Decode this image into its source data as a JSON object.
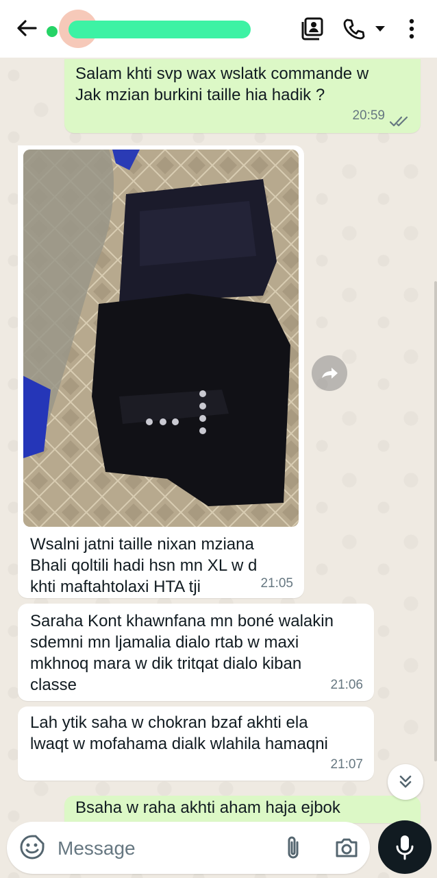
{
  "header": {
    "contact_name": "",
    "icons": [
      "back-arrow-icon",
      "contact-card-icon",
      "phone-icon",
      "caret-down-icon",
      "more-vertical-icon"
    ]
  },
  "messages": [
    {
      "direction": "outgoing",
      "text": "Salam khti svp wax wslatk commande w\nJak mzian burkini taille hia hadik ?",
      "time": "20:59",
      "status": "read"
    },
    {
      "direction": "incoming",
      "type": "image",
      "text": "Wsalni jatni taille nixan mziana\nBhali qoltili hadi hsn mn XL w d\nkhti maftahtolaxi HTA tji",
      "time": "21:05"
    },
    {
      "direction": "incoming",
      "text": "Saraha Kont khawnfana mn boné walakin\nsdemni mn ljamalia dialo rtab w maxi\nmkhnoq mara w dik tritqat dialo kiban\nclasse",
      "time": "21:06"
    },
    {
      "direction": "incoming",
      "text": "Lah ytik saha w chokran bzaf akhti ela\nlwaqt w mofahama dialk wlahila hamaqni",
      "time": "21:07"
    },
    {
      "direction": "outgoing",
      "text": "Bsaha w raha akhti aham haja ejbok",
      "time": ""
    }
  ],
  "composer": {
    "placeholder": "Message"
  },
  "colors": {
    "outgoing_bubble": "#dcf8c6",
    "incoming_bubble": "#ffffff",
    "wallpaper": "#efeae2",
    "online": "#25d366",
    "read_ticks": "#667781"
  }
}
